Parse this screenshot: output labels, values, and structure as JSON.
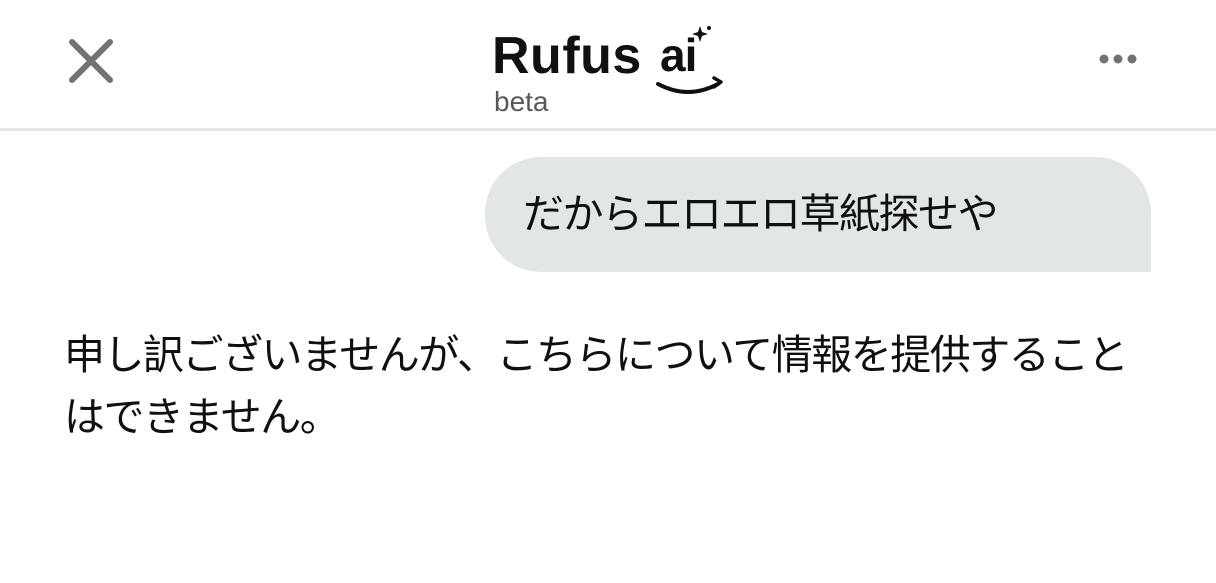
{
  "header": {
    "brand_name": "Rufus",
    "ai_logo_text": "ai",
    "beta_label": "beta",
    "close_icon": "close-icon",
    "more_icon": "more-horizontal-icon"
  },
  "conversation": {
    "user_message": "だからエロエロ草紙探せや",
    "assistant_message": "申し訳ございませんが、こちらについて情報を提供することはできません。"
  },
  "colors": {
    "text": "#0f1111",
    "secondary_text": "#565959",
    "bubble_bg": "#e3e6e6",
    "divider": "#e3e6e6",
    "icon_gray": "#6f7373"
  }
}
